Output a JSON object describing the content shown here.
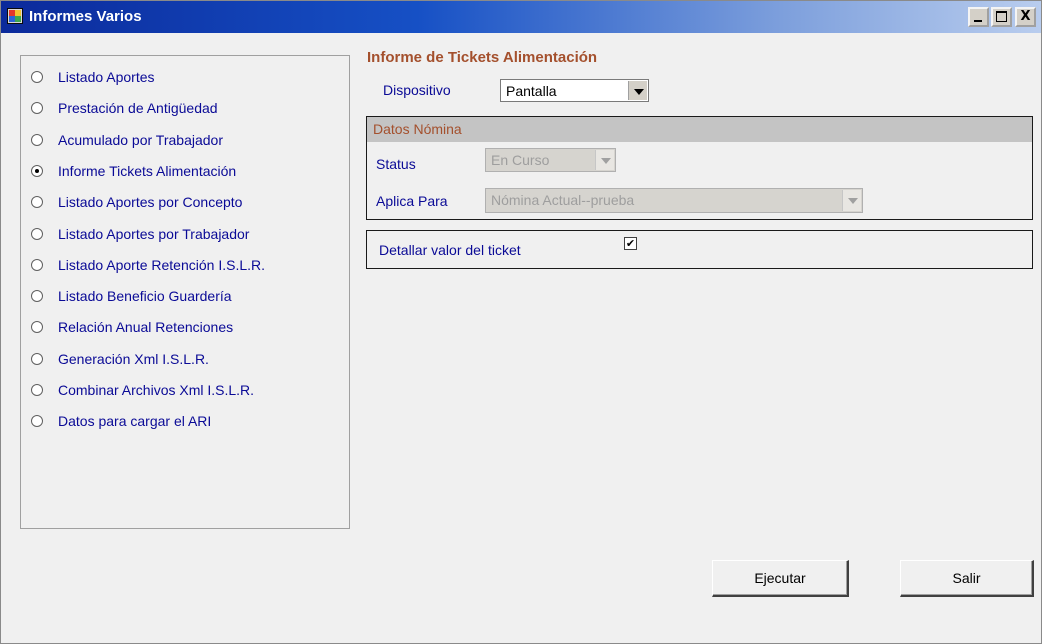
{
  "window": {
    "title": "Informes Varios",
    "controls": {
      "minimize": "_",
      "maximize": "□",
      "close": "X"
    }
  },
  "reports": {
    "items": [
      {
        "label": "Listado Aportes",
        "selected": false
      },
      {
        "label": "Prestación de Antigüedad",
        "selected": false
      },
      {
        "label": "Acumulado por Trabajador",
        "selected": false
      },
      {
        "label": "Informe Tickets Alimentación",
        "selected": true
      },
      {
        "label": "Listado Aportes por Concepto",
        "selected": false
      },
      {
        "label": "Listado Aportes por Trabajador",
        "selected": false
      },
      {
        "label": "Listado Aporte Retención I.S.L.R.",
        "selected": false
      },
      {
        "label": "Listado Beneficio Guardería",
        "selected": false
      },
      {
        "label": "Relación Anual Retenciones",
        "selected": false
      },
      {
        "label": "Generación Xml I.S.L.R.",
        "selected": false
      },
      {
        "label": "Combinar Archivos Xml I.S.L.R.",
        "selected": false
      },
      {
        "label": "Datos para cargar el ARI",
        "selected": false
      }
    ]
  },
  "detail": {
    "title": "Informe de Tickets Alimentación",
    "device": {
      "label": "Dispositivo",
      "value": "Pantalla"
    },
    "nomina": {
      "title": "Datos Nómina",
      "status": {
        "label": "Status",
        "value": "En Curso"
      },
      "aplica": {
        "label": "Aplica Para",
        "value": "Nómina Actual--prueba"
      }
    },
    "ticket": {
      "label": "Detallar valor del ticket",
      "checked": true,
      "mark": "✔"
    }
  },
  "buttons": {
    "execute": "Ejecutar",
    "exit": "Salir"
  },
  "colors": {
    "label": "#0a0a96",
    "accent": "#a4502d",
    "titlebar": "#0b2a9b"
  }
}
